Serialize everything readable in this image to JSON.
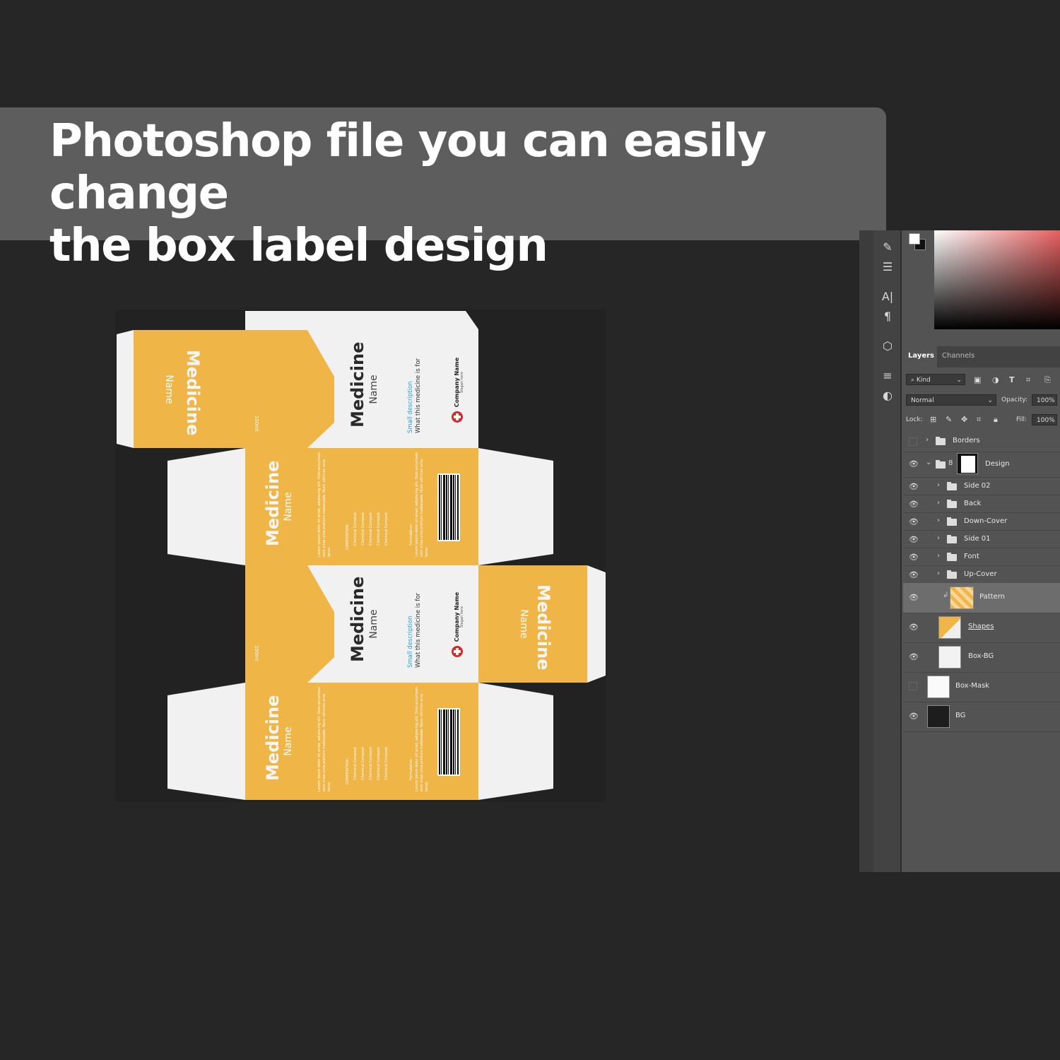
{
  "banner": {
    "line1": "Photoshop file you can easily change",
    "line2": "the box label design"
  },
  "box": {
    "title": "Medicine",
    "subtitle": "Name",
    "small_description": "Small description",
    "description": "What this medicine is for",
    "company": "Company Name",
    "slogan": "Slogan here",
    "composition_label": "COMPOSITION:",
    "formulation_label": "Formulation",
    "lorem": "Lorem ipsum dolor sit amet, adipiscing elit. Duis accumsan sem vitae urna pretium malesuada. Nunc ultricies urna lacus.",
    "compound": "Chemical Compost",
    "logo": "100ml",
    "colors": {
      "accent": "#efb547",
      "panel": "#f1f1f1",
      "cross": "#d42a2a",
      "blue": "#2a9fd8"
    }
  },
  "photoshop": {
    "tabs": [
      "Layers",
      "Channels"
    ],
    "filter_kind": "Kind",
    "blend_mode": "Normal",
    "opacity_label": "Opacity:",
    "opacity_value": "100%",
    "lock_label": "Lock:",
    "fill_label": "Fill:",
    "fill_value": "100%",
    "layers": [
      {
        "name": "Borders",
        "visible": false
      },
      {
        "name": "Design",
        "visible": true
      },
      {
        "name": "Side 02",
        "visible": true
      },
      {
        "name": "Back",
        "visible": true
      },
      {
        "name": "Down-Cover",
        "visible": true
      },
      {
        "name": "Side 01",
        "visible": true
      },
      {
        "name": "Font",
        "visible": true
      },
      {
        "name": "Up-Cover",
        "visible": true
      },
      {
        "name": "Pattern",
        "visible": true
      },
      {
        "name": "Shapes",
        "visible": true
      },
      {
        "name": "Box-BG",
        "visible": true
      },
      {
        "name": "Box-Mask",
        "visible": false
      },
      {
        "name": "BG",
        "visible": true
      }
    ]
  }
}
